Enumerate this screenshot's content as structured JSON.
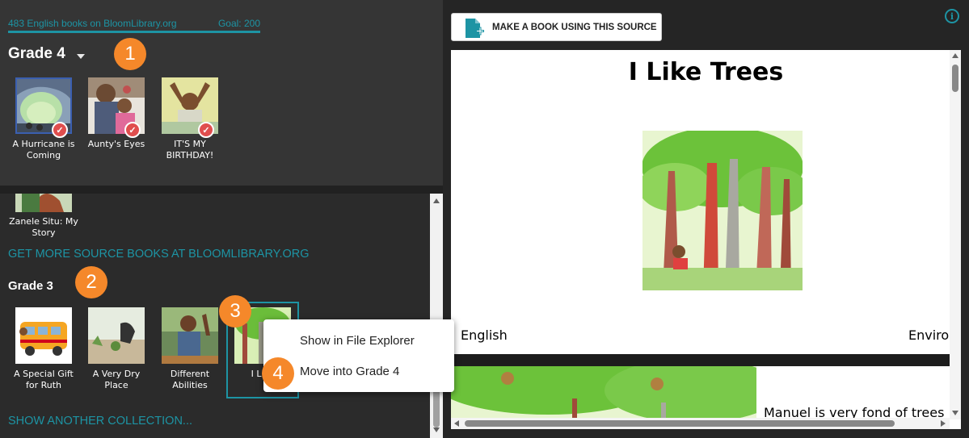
{
  "collection": {
    "book_count_label": "483 English books on BloomLibrary.org",
    "goal_label": "Goal: 200",
    "grade4": {
      "title": "Grade 4",
      "books": [
        {
          "title": "A Hurricane is Coming"
        },
        {
          "title": "Aunty's Eyes"
        },
        {
          "title": "IT'S MY BIRTHDAY!"
        }
      ]
    },
    "partial_book": {
      "title": "Zanele Situ: My Story"
    },
    "get_more_link": "GET MORE SOURCE BOOKS AT BLOOMLIBRARY.ORG",
    "grade3": {
      "title": "Grade 3",
      "books": [
        {
          "title": "A Special Gift for Ruth"
        },
        {
          "title": "A Very Dry Place"
        },
        {
          "title": "Different Abilities"
        },
        {
          "title": "I Like"
        }
      ]
    },
    "show_another_link": "SHOW ANOTHER COLLECTION..."
  },
  "badges": [
    "1",
    "2",
    "3",
    "4"
  ],
  "context_menu": {
    "items": [
      "Show in File Explorer",
      "Move into Grade 4"
    ]
  },
  "toolbar": {
    "make_book_label": "MAKE A BOOK USING THIS SOURCE",
    "info_icon_glyph": "i"
  },
  "preview": {
    "title": "I Like Trees",
    "language": "English",
    "topic": "Envirom",
    "page2_text": "Manuel is very fond of trees"
  },
  "icons": {
    "make_book": "document-plus-icon",
    "info": "info-icon",
    "check": "check-badge-icon",
    "dropdown": "caret-down-icon"
  },
  "colors": {
    "accent": "#1d94a4",
    "badge": "#f5882a",
    "check": "#e04e4e"
  }
}
